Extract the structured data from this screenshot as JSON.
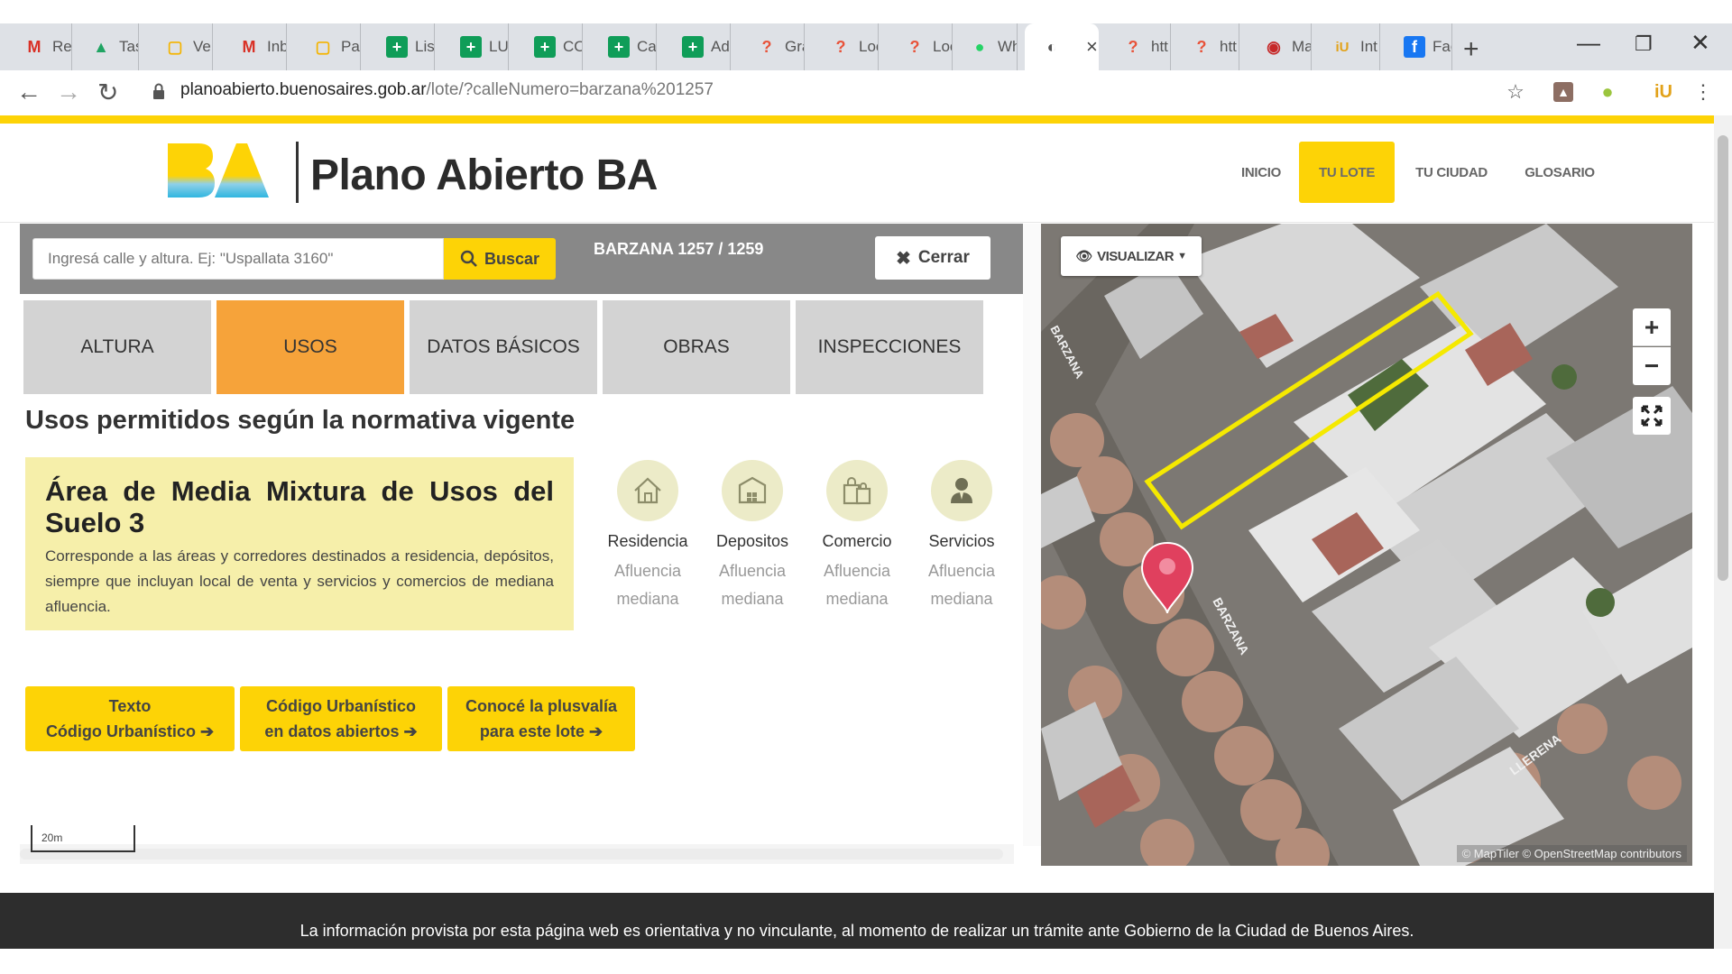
{
  "browser": {
    "tabs": [
      {
        "icon": "M",
        "color": "#d93025",
        "label": "Rec"
      },
      {
        "icon": "▲",
        "color": "#1fa463",
        "label": "Tas"
      },
      {
        "icon": "▢",
        "color": "#f4b400",
        "label": "Ver"
      },
      {
        "icon": "M",
        "color": "#d93025",
        "label": "Inb"
      },
      {
        "icon": "▢",
        "color": "#f4b400",
        "label": "Pas"
      },
      {
        "icon": "+",
        "color": "#0f9d58",
        "label": "List"
      },
      {
        "icon": "+",
        "color": "#0f9d58",
        "label": "LU("
      },
      {
        "icon": "+",
        "color": "#0f9d58",
        "label": "CO"
      },
      {
        "icon": "+",
        "color": "#0f9d58",
        "label": "Ca"
      },
      {
        "icon": "+",
        "color": "#0f9d58",
        "label": "Adi"
      },
      {
        "icon": "?",
        "color": "#e8533a",
        "label": "Gra"
      },
      {
        "icon": "?",
        "color": "#e8533a",
        "label": "Loc"
      },
      {
        "icon": "?",
        "color": "#e8533a",
        "label": "Loc"
      },
      {
        "icon": "●",
        "color": "#25d366",
        "label": "Wh"
      },
      {
        "icon": "◐",
        "color": "#555555",
        "label": "",
        "active": true
      },
      {
        "icon": "?",
        "color": "#e8533a",
        "label": "htt"
      },
      {
        "icon": "?",
        "color": "#e8533a",
        "label": "htt"
      },
      {
        "icon": "◉",
        "color": "#c62828",
        "label": "Ma"
      },
      {
        "icon": "iU",
        "color": "#e2a21a",
        "label": "Int"
      },
      {
        "icon": "f",
        "color": "#1877f2",
        "label": "Fac"
      }
    ],
    "close_glyph": "×",
    "new_tab_glyph": "+",
    "window_controls": {
      "minimize": "—",
      "restore": "❐",
      "close": "✕"
    },
    "url_host": "planoabierto.buenosaires.gob.ar",
    "url_path": "/lote/?calleNumero=barzana%201257"
  },
  "site": {
    "title": "Plano Abierto BA",
    "nav": [
      {
        "label": "INICIO",
        "active": false
      },
      {
        "label": "TU LOTE",
        "active": true
      },
      {
        "label": "TU CIUDAD",
        "active": false
      },
      {
        "label": "GLOSARIO",
        "active": false
      }
    ]
  },
  "search": {
    "placeholder": "Ingresá calle y altura. Ej: \"Uspallata 3160\"",
    "button": "Buscar",
    "address": "BARZANA 1257 / 1259",
    "close": "Cerrar"
  },
  "tabs": [
    {
      "label": "ALTURA",
      "active": false
    },
    {
      "label": "USOS",
      "active": true
    },
    {
      "label": "DATOS BÁSICOS",
      "active": false
    },
    {
      "label": "OBRAS",
      "active": false
    },
    {
      "label": "INSPECCIONES",
      "active": false
    }
  ],
  "usos": {
    "heading": "Usos permitidos según la normativa vigente",
    "area_title": "Área de Media Mixtura de Usos del Suelo 3",
    "area_desc": "Corresponde a las áreas y corredores destinados a residencia, depósitos, siempre que incluyan local de venta y servicios y comercios de mediana afluencia.",
    "items": [
      {
        "icon": "house-icon",
        "name": "Residencia",
        "sub1": "Afluencia",
        "sub2": "mediana"
      },
      {
        "icon": "warehouse-icon",
        "name": "Depositos",
        "sub1": "Afluencia",
        "sub2": "mediana"
      },
      {
        "icon": "shopping-bags-icon",
        "name": "Comercio",
        "sub1": "Afluencia",
        "sub2": "mediana"
      },
      {
        "icon": "person-icon",
        "name": "Servicios",
        "sub1": "Afluencia",
        "sub2": "mediana"
      }
    ]
  },
  "actions": [
    {
      "line1": "Texto",
      "line2": "Código Urbanístico"
    },
    {
      "line1": "Código Urbanístico",
      "line2": "en datos abiertos"
    },
    {
      "line1": "Conocé la plusvalía",
      "line2": "para este lote"
    }
  ],
  "arrow_glyph": "➔",
  "scale_label": "20m",
  "map": {
    "visualize": "VISUALIZAR",
    "zoom_in": "+",
    "zoom_out": "−",
    "street_barzana": "BARZANA",
    "street_llerena": "LLERENA",
    "attribution": "© MapTiler © OpenStreetMap contributors",
    "parcel_color": "#f5e900",
    "marker_color": "#e0405e"
  },
  "footer": {
    "text": "La información provista por esta página web es orientativa y no vinculante, al momento de realizar un trámite ante Gobierno de la Ciudad de Buenos Aires."
  },
  "colors": {
    "brand_yellow": "#fdd306",
    "active_tab_orange": "#f6a33a",
    "area_bg": "#f6efaa"
  }
}
